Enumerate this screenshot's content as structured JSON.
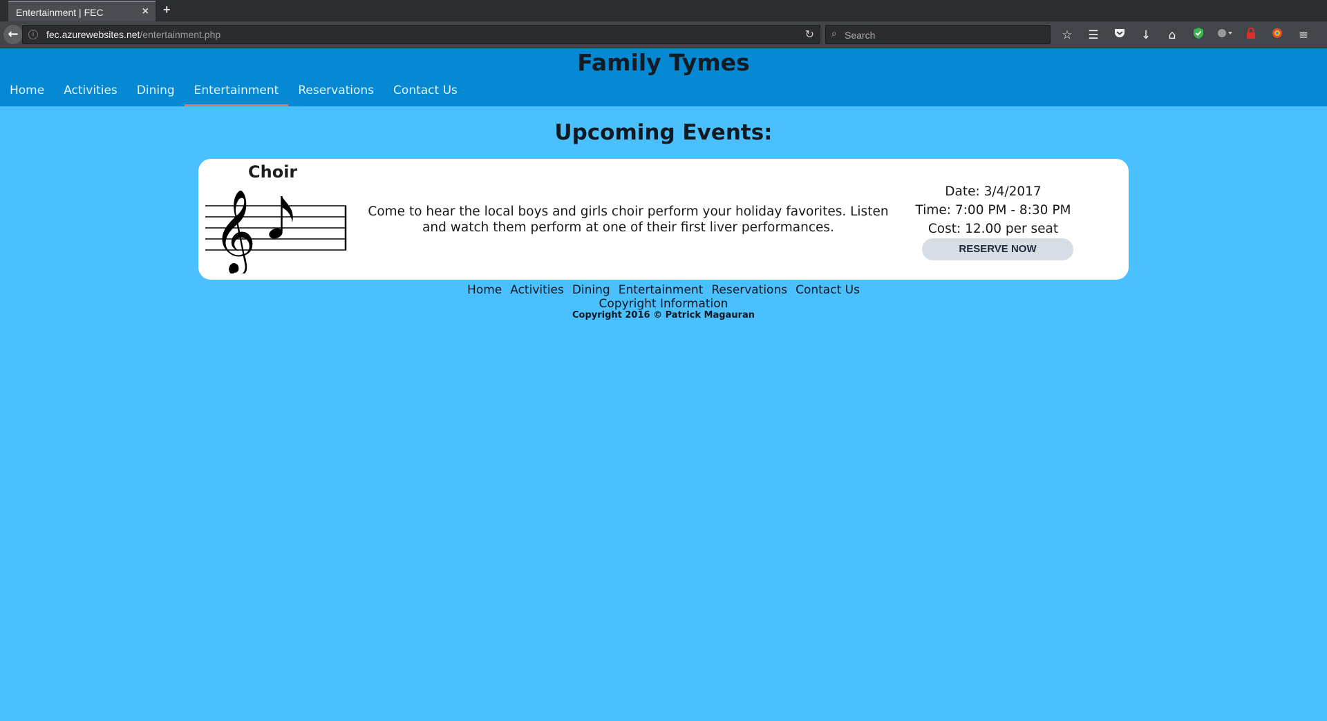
{
  "browser": {
    "tab_title": "Entertainment | FEC",
    "tab_close": "×",
    "new_tab": "+",
    "url_domain": "fec.azurewebsites.net",
    "url_path": "/entertainment.php",
    "search_placeholder": "Search",
    "toolbar_icons": [
      "star-icon",
      "reading-list-icon",
      "pocket-icon",
      "download-icon",
      "home-icon",
      "shield-icon",
      "extension-icon",
      "lock-icon",
      "browser-extension-icon",
      "menu-icon"
    ]
  },
  "site": {
    "title": "Family Tymes",
    "nav": [
      "Home",
      "Activities",
      "Dining",
      "Entertainment",
      "Reservations",
      "Contact Us"
    ],
    "active_nav": "Entertainment"
  },
  "main": {
    "heading": "Upcoming Events:",
    "event": {
      "title": "Choir",
      "description": "Come to hear the local boys and girls choir perform your holiday favorites. Listen and watch them perform at one of their first liver performances.",
      "date": "Date: 3/4/2017",
      "time": "Time: 7:00 PM - 8:30 PM",
      "cost": "Cost: 12.00 per seat",
      "reserve_label": "RESERVE NOW"
    }
  },
  "footer": {
    "nav": [
      "Home",
      "Activities",
      "Dining",
      "Entertainment",
      "Reservations",
      "Contact Us"
    ],
    "copyright_info": "Copyright Information",
    "copyright_text": "Copyright 2016 © Patrick Magauran"
  },
  "colors": {
    "page_bg": "#4bc0ff",
    "header_bg": "#0489d2",
    "active_underline": "#e07a5f",
    "button_bg": "#d6dde4"
  }
}
